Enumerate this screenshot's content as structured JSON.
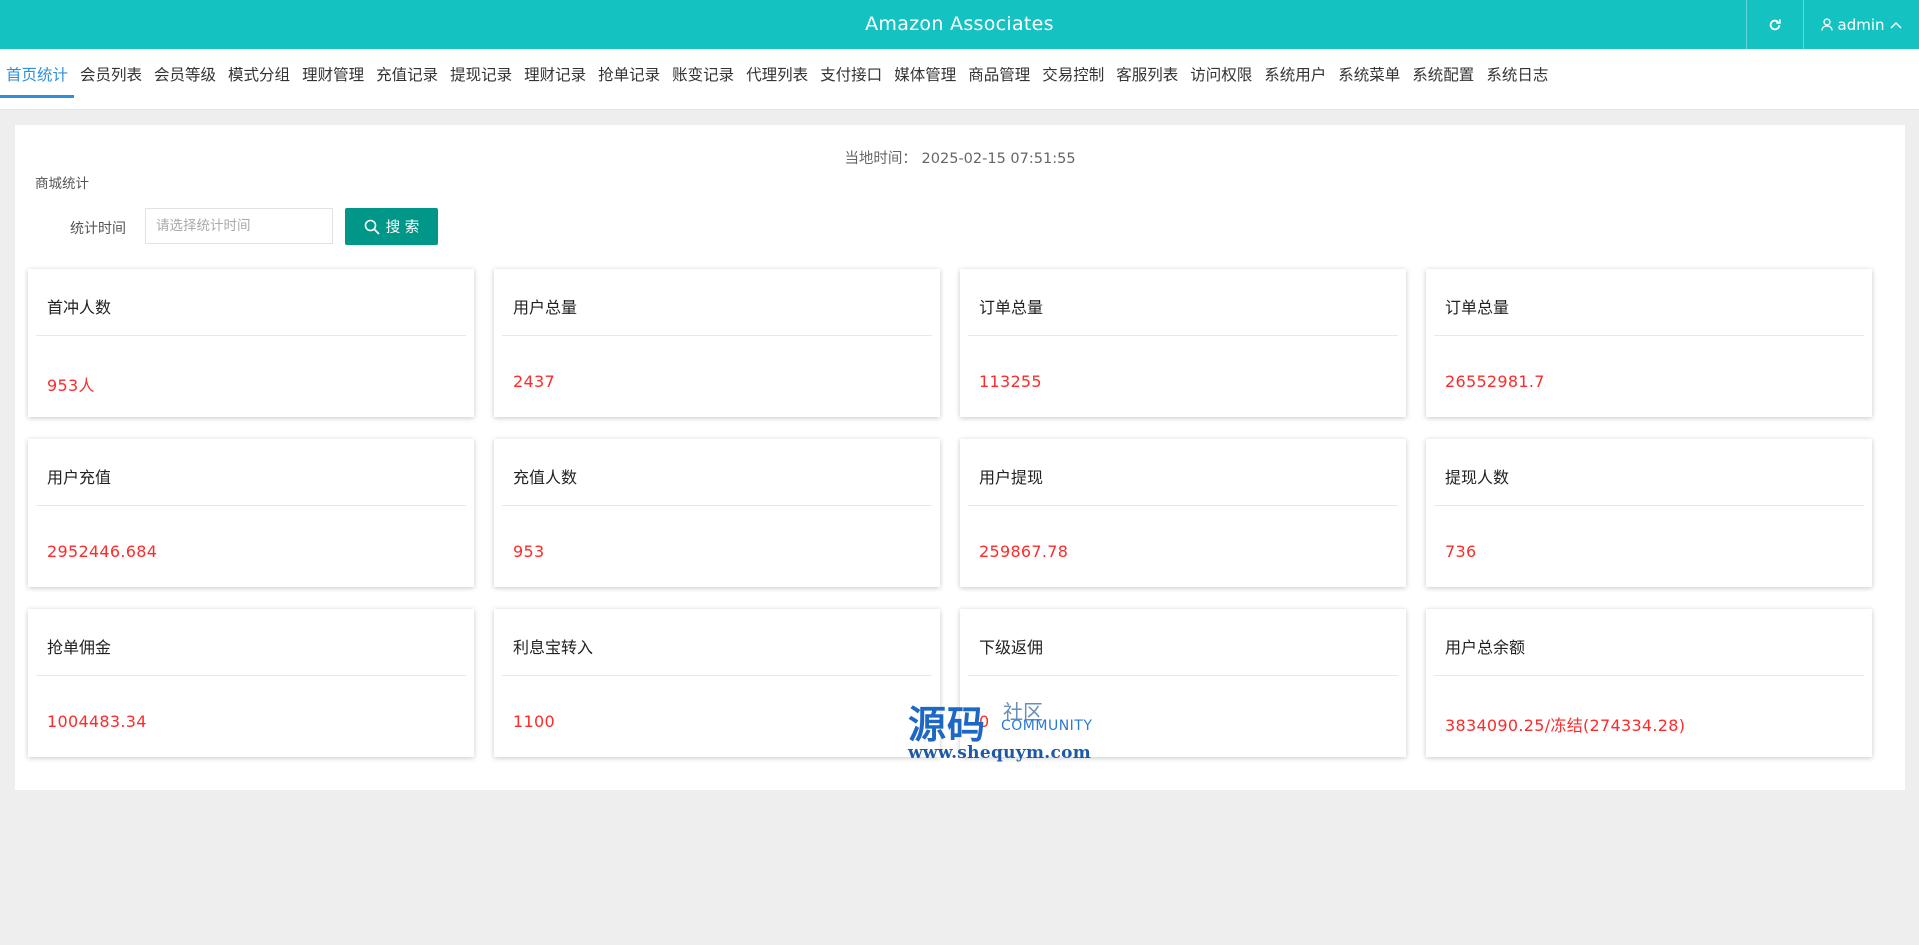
{
  "header": {
    "title": "Amazon Associates",
    "user": "admin",
    "bg_color": "#15c2c2"
  },
  "nav": {
    "tabs": [
      {
        "label": "首页统计",
        "active": true
      },
      {
        "label": "会员列表"
      },
      {
        "label": "会员等级"
      },
      {
        "label": "模式分组"
      },
      {
        "label": "理财管理"
      },
      {
        "label": "充值记录"
      },
      {
        "label": "提现记录"
      },
      {
        "label": "理财记录"
      },
      {
        "label": "抢单记录"
      },
      {
        "label": "账变记录"
      },
      {
        "label": "代理列表"
      },
      {
        "label": "支付接口"
      },
      {
        "label": "媒体管理"
      },
      {
        "label": "商品管理"
      },
      {
        "label": "交易控制"
      },
      {
        "label": "客服列表"
      },
      {
        "label": "访问权限"
      },
      {
        "label": "系统用户"
      },
      {
        "label": "系统菜单"
      },
      {
        "label": "系统配置"
      },
      {
        "label": "系统日志"
      }
    ]
  },
  "main": {
    "local_time_label": "当地时间：",
    "local_time_value": "2025-02-15 07:51:55",
    "section_label": "商城统计",
    "search": {
      "label": "统计时间",
      "placeholder": "请选择统计时间",
      "button": "搜 索"
    },
    "cards": [
      {
        "title": "首冲人数",
        "value": "953人"
      },
      {
        "title": "用户总量",
        "value": "2437"
      },
      {
        "title": "订单总量",
        "value": "113255"
      },
      {
        "title": "订单总量",
        "value": "26552981.7"
      },
      {
        "title": "用户充值",
        "value": "2952446.684"
      },
      {
        "title": "充值人数",
        "value": "953"
      },
      {
        "title": "用户提现",
        "value": "259867.78"
      },
      {
        "title": "提现人数",
        "value": "736"
      },
      {
        "title": "抢单佣金",
        "value": "1004483.34"
      },
      {
        "title": "利息宝转入",
        "value": "1100"
      },
      {
        "title": "下级返佣",
        "value": "0"
      },
      {
        "title": "用户总余额",
        "value": "3834090.25/冻结(274334.28)"
      }
    ],
    "value_color": "#ff2a2a"
  },
  "watermark": {
    "main": "源码",
    "sub1": "社区",
    "sub2": "COMMUNITY",
    "url": "www.shequym.com"
  }
}
